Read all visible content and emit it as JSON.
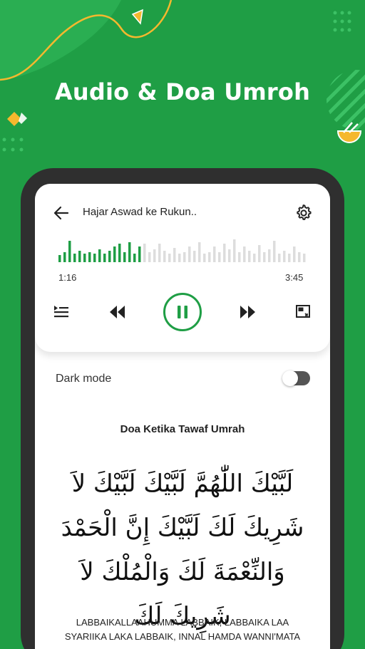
{
  "headline": "Audio & Doa Umroh",
  "player": {
    "title": "Hajar Aswad ke Rukun..",
    "elapsed": "1:16",
    "duration": "3:45",
    "progress": 0.34,
    "is_playing": true
  },
  "settings": {
    "dark_mode_label": "Dark mode",
    "dark_mode_on": false
  },
  "doa": {
    "title": "Doa Ketika Tawaf Umrah",
    "arabic": "لَبَّيْكَ اللّٰهُمَّ لَبَّيْكَ لَبَّيْكَ لاَ شَرِيكَ لَكَ لَبَّيْكَ إِنَّ الْحَمْدَ وَالنِّعْمَةَ لَكَ وَالْمُلْكَ لاَ شَرِيكَ لَكَ",
    "latin_line1": "LABBAIKALLAAHUMMA LABBAIK, LABBAIKA LAA",
    "latin_line2": "SYARIIKA LAKA LABBAIK, INNAL HAMDA WANNI'MATA"
  },
  "colors": {
    "brand_green": "#1f9e45",
    "accent_yellow": "#f5b82e",
    "wave_played": "#1f9e45",
    "wave_unplayed": "#dddddd",
    "phone_frame": "#2f2f2f"
  },
  "icons": {
    "back": "arrow-left-icon",
    "settings": "gear-icon",
    "playlist": "playlist-icon",
    "rewind": "rewind-icon",
    "pause": "pause-icon",
    "forward": "fast-forward-icon",
    "pip": "picture-in-picture-icon"
  }
}
